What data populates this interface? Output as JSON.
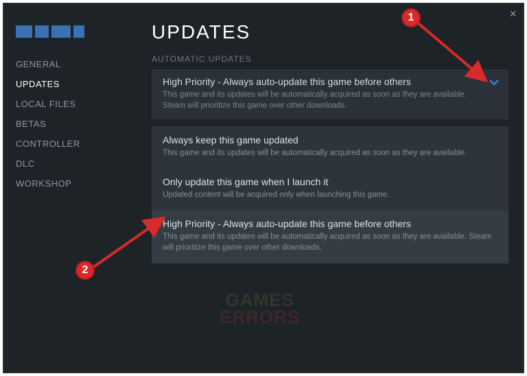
{
  "sidebar": {
    "items": [
      {
        "label": "GENERAL"
      },
      {
        "label": "UPDATES"
      },
      {
        "label": "LOCAL FILES"
      },
      {
        "label": "BETAS"
      },
      {
        "label": "CONTROLLER"
      },
      {
        "label": "DLC"
      },
      {
        "label": "WORKSHOP"
      }
    ]
  },
  "main": {
    "title": "UPDATES",
    "section_header": "AUTOMATIC UPDATES"
  },
  "dropdown": {
    "selected": {
      "title": "High Priority - Always auto-update this game before others",
      "desc": "This game and its updates will be automatically acquired as soon as they are available. Steam will prioritize this game over other downloads."
    },
    "options": [
      {
        "title": "Always keep this game updated",
        "desc": "This game and its updates will be automatically acquired as soon as they are available."
      },
      {
        "title": "Only update this game when I launch it",
        "desc": "Updated content will be acquired only when launching this game."
      },
      {
        "title": "High Priority - Always auto-update this game before others",
        "desc": "This game and its updates will be automatically acquired as soon as they are available. Steam will prioritize this game over other downloads."
      }
    ]
  },
  "watermark": {
    "line1": "GAMES",
    "line2": "ERRORS"
  },
  "annotations": {
    "badge1": "1",
    "badge2": "2"
  }
}
